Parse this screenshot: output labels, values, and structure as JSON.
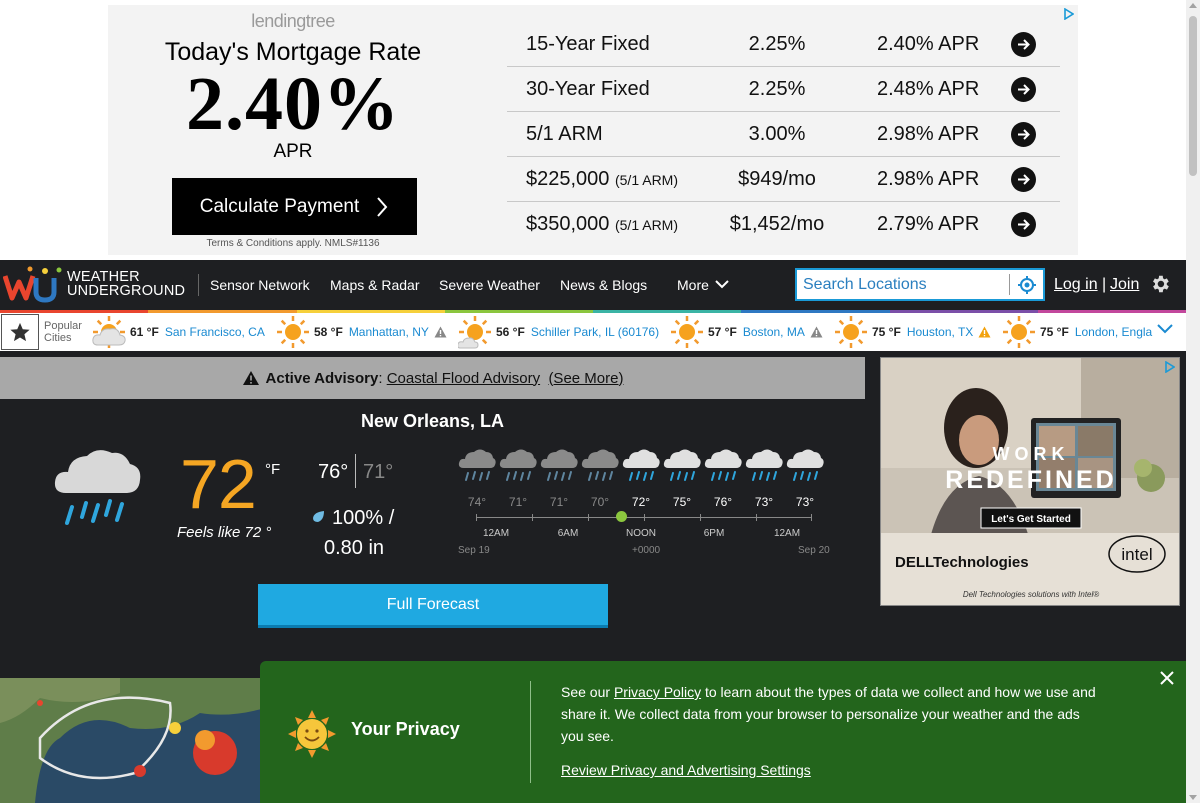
{
  "ad_top": {
    "logo": "lendingtree",
    "headline": "Today's Mortgage Rate",
    "rate": "2.40%",
    "rate_unit": "APR",
    "cta": "Calculate Payment",
    "terms": "Terms & Conditions apply. NMLS#1136",
    "rows": [
      {
        "product": "15-Year Fixed",
        "product_note": "",
        "rate": "2.25%",
        "apr": "2.40% APR"
      },
      {
        "product": "30-Year Fixed",
        "product_note": "",
        "rate": "2.25%",
        "apr": "2.48% APR"
      },
      {
        "product": "5/1 ARM",
        "product_note": "",
        "rate": "3.00%",
        "apr": "2.98% APR"
      },
      {
        "product": "$225,000",
        "product_note": "(5/1 ARM)",
        "rate": "$949/mo",
        "apr": "2.98% APR"
      },
      {
        "product": "$350,000",
        "product_note": "(5/1 ARM)",
        "rate": "$1,452/mo",
        "apr": "2.79% APR"
      }
    ]
  },
  "nav": {
    "logo_line1": "WEATHER",
    "logo_line2": "UNDERGROUND",
    "items": [
      "Sensor Network",
      "Maps & Radar",
      "Severe Weather",
      "News & Blogs",
      "More"
    ],
    "search_placeholder": "Search Locations",
    "login": "Log in",
    "separator": "|",
    "join": "Join"
  },
  "rainbow_colors": [
    "#e9452e",
    "#f29a2e",
    "#f6d03b",
    "#8bc63e",
    "#3bb4a5",
    "#2e78c2",
    "#7b4fa8",
    "#c2479c"
  ],
  "popular": {
    "label_line1": "Popular",
    "label_line2": "Cities",
    "cities": [
      {
        "temp": "61 °F",
        "name": "San Francisco, CA",
        "icon": "partly-cloudy-icon",
        "warning": ""
      },
      {
        "temp": "58 °F",
        "name": "Manhattan, NY",
        "icon": "sunny-icon",
        "warning": "gray"
      },
      {
        "temp": "56 °F",
        "name": "Schiller Park, IL (60176)",
        "icon": "mostly-sunny-icon",
        "warning": ""
      },
      {
        "temp": "57 °F",
        "name": "Boston, MA",
        "icon": "sunny-icon",
        "warning": "gray"
      },
      {
        "temp": "75 °F",
        "name": "Houston, TX",
        "icon": "sunny-icon",
        "warning": "orange"
      },
      {
        "temp": "75 °F",
        "name": "London, Engla",
        "icon": "sunny-icon",
        "warning": ""
      }
    ]
  },
  "advisory": {
    "label": "Active Advisory",
    "colon": ":",
    "link": "Coastal Flood Advisory",
    "see_more": "(See More)"
  },
  "current": {
    "city": "New Orleans, LA",
    "condition_icon": "rain-icon",
    "temp": "72",
    "unit": "°F",
    "feels_like": "Feels like 72 °",
    "high": "76°",
    "low": "71°",
    "precip_pct": "100% /",
    "precip_amt": "0.80 in"
  },
  "hourly": {
    "hours": [
      {
        "temp": "74°",
        "icon": "rain-icon",
        "past": true
      },
      {
        "temp": "71°",
        "icon": "rain-icon",
        "past": true
      },
      {
        "temp": "71°",
        "icon": "rain-icon",
        "past": true
      },
      {
        "temp": "70°",
        "icon": "rain-icon",
        "past": true
      },
      {
        "temp": "72°",
        "icon": "rain-icon",
        "past": false
      },
      {
        "temp": "75°",
        "icon": "rain-icon",
        "past": false
      },
      {
        "temp": "76°",
        "icon": "rain-icon",
        "past": false
      },
      {
        "temp": "73°",
        "icon": "rain-icon",
        "past": false
      },
      {
        "temp": "73°",
        "icon": "rain-icon",
        "past": false
      }
    ],
    "labels": [
      "12AM",
      "6AM",
      "NOON",
      "6PM",
      "12AM"
    ],
    "start_date": "Sep 19",
    "tz": "+0000",
    "end_date": "Sep 20"
  },
  "full_forecast": "Full Forecast",
  "side_ad": {
    "line1": "WORK",
    "line2": "REDEFINED",
    "cta": "Let's Get Started",
    "brand": "DELLTechnologies",
    "partner": "intel",
    "footer": "Dell Technologies solutions with Intel®"
  },
  "privacy": {
    "title": "Your Privacy",
    "text_before": "See our ",
    "policy_link": "Privacy Policy",
    "text_after": " to learn about the types of data we collect and how we use and share it. We collect data from your browser to personalize your weather and the ads you see.",
    "settings_link": "Review Privacy and Advertising Settings"
  }
}
